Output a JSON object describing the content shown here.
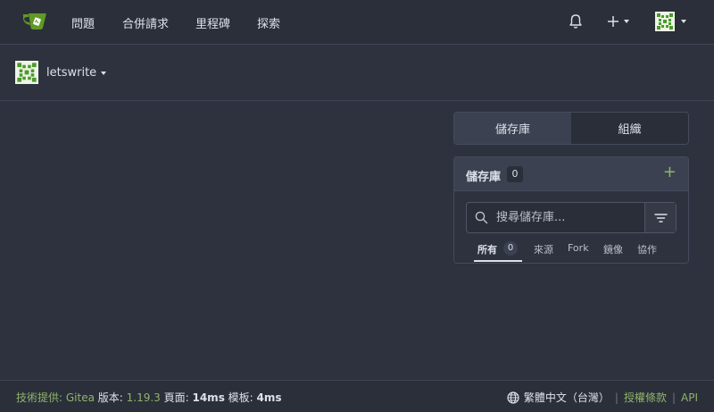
{
  "nav": {
    "items": [
      "問題",
      "合併請求",
      "里程碑",
      "探索"
    ]
  },
  "org": {
    "name": "letswrite"
  },
  "switch": {
    "repos_label": "儲存庫",
    "orgs_label": "組織"
  },
  "repo_panel": {
    "title": "儲存庫",
    "count": "0",
    "add_label": "+",
    "search_placeholder": "搜尋儲存庫...",
    "filters": [
      {
        "label": "所有",
        "count": "0"
      },
      {
        "label": "來源"
      },
      {
        "label": "Fork"
      },
      {
        "label": "鏡像"
      },
      {
        "label": "協作"
      }
    ]
  },
  "footer": {
    "powered_prefix": "技術提供: ",
    "gitea": "Gitea",
    "version_prefix": " 版本: ",
    "version": "1.19.3",
    "page_prefix": " 頁面: ",
    "page_time": "14ms",
    "template_prefix": " 模板: ",
    "template_time": "4ms",
    "language": "繁體中文（台灣）",
    "license": "授權條款",
    "api": "API"
  },
  "colors": {
    "accent_green": "#8fb36b",
    "background": "#2e323e",
    "navbar": "#2b2f3a"
  },
  "icons": [
    "gitea-logo-icon",
    "bell-icon",
    "plus-icon",
    "avatar",
    "search-icon",
    "filter-icon",
    "globe-icon"
  ]
}
